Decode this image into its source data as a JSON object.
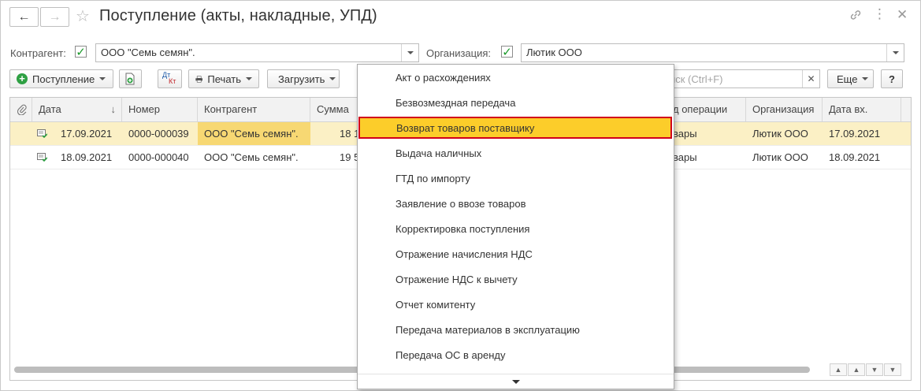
{
  "window": {
    "title": "Поступление (акты, накладные, УПД)"
  },
  "filters": {
    "counterparty_label": "Контрагент:",
    "counterparty_value": "ООО \"Семь семян\".",
    "organization_label": "Организация:",
    "organization_value": "Лютик ООО"
  },
  "toolbar": {
    "receipt_label": "Поступление",
    "dt_label": "Дт",
    "kt_label": "Кт",
    "print_label": "Печать",
    "load_label": "Загрузить",
    "search_placeholder": "иск (Ctrl+F)",
    "more_label": "Еще",
    "help_label": "?"
  },
  "table": {
    "headers": {
      "date": "Дата",
      "number": "Номер",
      "counterparty": "Контрагент",
      "sum": "Сумма",
      "operation": "д операции",
      "organization": "Организация",
      "date_in": "Дата вх."
    },
    "rows": [
      {
        "date": "17.09.2021",
        "number": "0000-000039",
        "counterparty": "ООО \"Семь семян\".",
        "sum": "18 1",
        "operation": "вары",
        "organization": "Лютик ООО",
        "date_in": "17.09.2021"
      },
      {
        "date": "18.09.2021",
        "number": "0000-000040",
        "counterparty": "ООО \"Семь семян\".",
        "sum": "19 5",
        "operation": "вары",
        "organization": "Лютик ООО",
        "date_in": "18.09.2021"
      }
    ]
  },
  "menu": {
    "items": [
      "Акт о расхождениях",
      "Безвозмездная передача",
      "Возврат товаров поставщику",
      "Выдача наличных",
      "ГТД по импорту",
      "Заявление о ввозе товаров",
      "Корректировка поступления",
      "Отражение начисления НДС",
      "Отражение НДС к вычету",
      "Отчет комитенту",
      "Передача материалов в эксплуатацию",
      "Передача ОС в аренду"
    ],
    "highlighted_index": 2
  },
  "colors": {
    "highlight_fill": "#fccd2a",
    "highlight_border": "#d1001b",
    "selected_row": "#fbf0c5",
    "check_green": "#1a9a2a"
  }
}
